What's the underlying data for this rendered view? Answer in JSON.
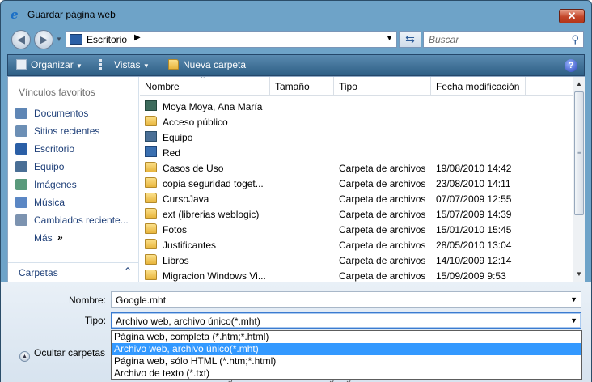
{
  "window": {
    "title": "Guardar página web",
    "close_label": "✕"
  },
  "address": {
    "location": "Escritorio",
    "search_placeholder": "Buscar"
  },
  "toolbar": {
    "organize": "Organizar",
    "views": "Vistas",
    "new_folder": "Nueva carpeta",
    "help": "?"
  },
  "sidebar": {
    "header": "Vínculos favoritos",
    "items": [
      {
        "label": "Documentos",
        "icon": "documents-icon",
        "color": "#5f86b5"
      },
      {
        "label": "Sitios recientes",
        "icon": "recent-sites-icon",
        "color": "#6c8fb5"
      },
      {
        "label": "Escritorio",
        "icon": "desktop-icon",
        "color": "#2b5fa6"
      },
      {
        "label": "Equipo",
        "icon": "computer-icon",
        "color": "#4a6f96"
      },
      {
        "label": "Imágenes",
        "icon": "pictures-icon",
        "color": "#5a9a7c"
      },
      {
        "label": "Música",
        "icon": "music-icon",
        "color": "#5b87c4"
      },
      {
        "label": "Cambiados reciente...",
        "icon": "recently-changed-icon",
        "color": "#7c93b0"
      },
      {
        "label": "Más",
        "icon": "more-chevron-icon",
        "color": "#1e3f78"
      }
    ],
    "more_glyph": "»",
    "folders": "Carpetas",
    "folders_chevron": "⌃"
  },
  "files": {
    "columns": [
      "Nombre",
      "Tamaño",
      "Tipo",
      "Fecha modificación"
    ],
    "rows": [
      {
        "name": "Moya Moya, Ana María",
        "type": "",
        "date": "",
        "icon": "user-folder-icon"
      },
      {
        "name": "Acceso público",
        "type": "",
        "date": "",
        "icon": "folder-icon"
      },
      {
        "name": "Equipo",
        "type": "",
        "date": "",
        "icon": "computer-icon"
      },
      {
        "name": "Red",
        "type": "",
        "date": "",
        "icon": "network-icon"
      },
      {
        "name": "Casos de Uso",
        "type": "Carpeta de archivos",
        "date": "19/08/2010 14:42",
        "icon": "folder-icon"
      },
      {
        "name": "copia seguridad toget...",
        "type": "Carpeta de archivos",
        "date": "23/08/2010 14:11",
        "icon": "folder-icon"
      },
      {
        "name": "CursoJava",
        "type": "Carpeta de archivos",
        "date": "07/07/2009 12:55",
        "icon": "folder-icon"
      },
      {
        "name": "ext (librerias weblogic)",
        "type": "Carpeta de archivos",
        "date": "15/07/2009 14:39",
        "icon": "folder-icon"
      },
      {
        "name": "Fotos",
        "type": "Carpeta de archivos",
        "date": "15/01/2010 15:45",
        "icon": "folder-icon"
      },
      {
        "name": "Justificantes",
        "type": "Carpeta de archivos",
        "date": "28/05/2010 13:04",
        "icon": "folder-icon"
      },
      {
        "name": "Libros",
        "type": "Carpeta de archivos",
        "date": "14/10/2009 12:14",
        "icon": "folder-icon"
      },
      {
        "name": "Migracion Windows Vi...",
        "type": "Carpeta de archivos",
        "date": "15/09/2009 9:53",
        "icon": "folder-icon"
      }
    ]
  },
  "form": {
    "name_label": "Nombre:",
    "name_value": "Google.mht",
    "type_label": "Tipo:",
    "type_value": "Archivo web, archivo único(*.mht)",
    "type_options": [
      "Página web, completa (*.htm;*.html)",
      "Archivo web, archivo único(*.mht)",
      "Página web, sólo HTML (*.htm;*.html)",
      "Archivo de texto (*.txt)"
    ],
    "selected_option": 1
  },
  "footer": {
    "hide_folders": "Ocultar carpetas",
    "background_text": "Google.es ofrecido en: català galego euskara"
  },
  "colors": {
    "accent": "#3399ff",
    "toolbar": "#2e5f85",
    "link": "#1e3f78"
  }
}
